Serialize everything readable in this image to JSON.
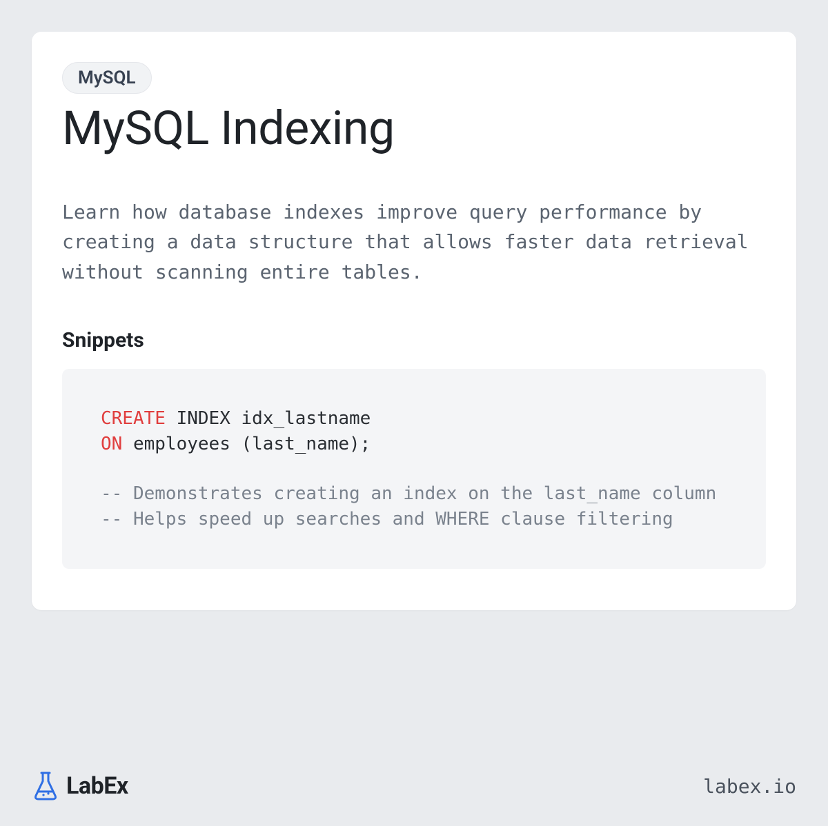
{
  "tag": "MySQL",
  "title": "MySQL Indexing",
  "description": "Learn how database indexes improve query performance by creating a data structure that allows faster data retrieval without scanning entire tables.",
  "section_title": "Snippets",
  "code": {
    "line1_kw": "CREATE",
    "line1_rest": " INDEX idx_lastname",
    "line2_kw": "ON",
    "line2_rest": " employees (last_name);",
    "comment1": "-- Demonstrates creating an index on the last_name column",
    "comment2": "-- Helps speed up searches and WHERE clause filtering"
  },
  "brand_name": "LabEx",
  "site": "labex.io"
}
